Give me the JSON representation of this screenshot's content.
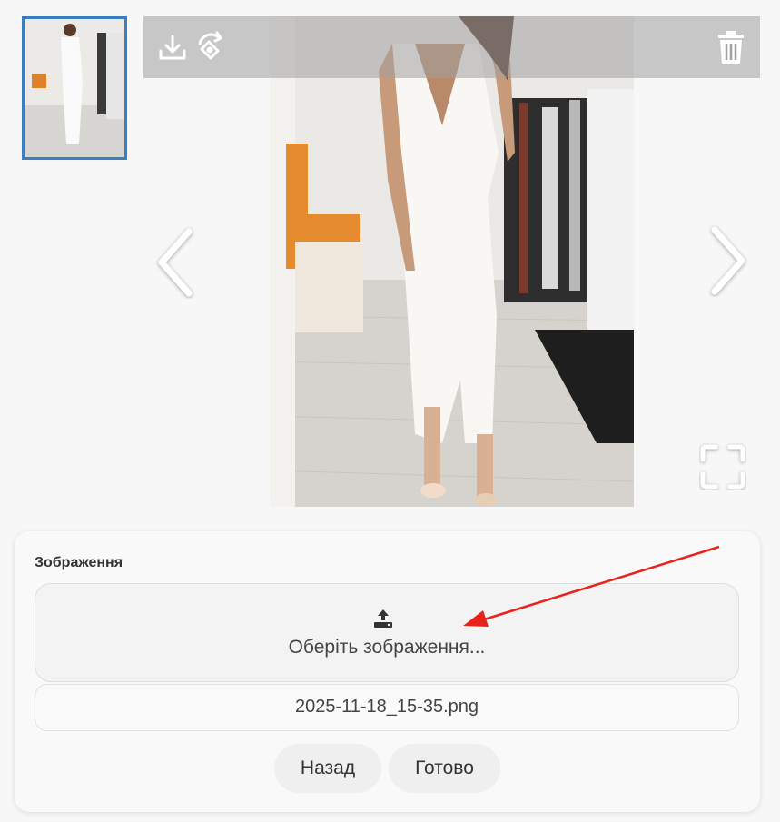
{
  "thumbnail": {
    "icon": "photo-thumbnail"
  },
  "toolbar": {
    "icons": [
      "download-icon",
      "rotate-image-icon",
      "trash-icon"
    ]
  },
  "navigation": {
    "prev_icon": "chevron-left-icon",
    "next_icon": "chevron-right-icon"
  },
  "fullscreen_icon": "fullscreen-icon",
  "form": {
    "section_label": "Зображення",
    "dropzone_text": "Оберіть зображення...",
    "dropzone_icon": "upload-icon",
    "filename": "2025-11-18_15-35.png",
    "back_label": "Назад",
    "done_label": "Готово"
  },
  "colors": {
    "thumbnail_border": "#3a7ebf",
    "annotation_arrow": "#e8221b"
  }
}
